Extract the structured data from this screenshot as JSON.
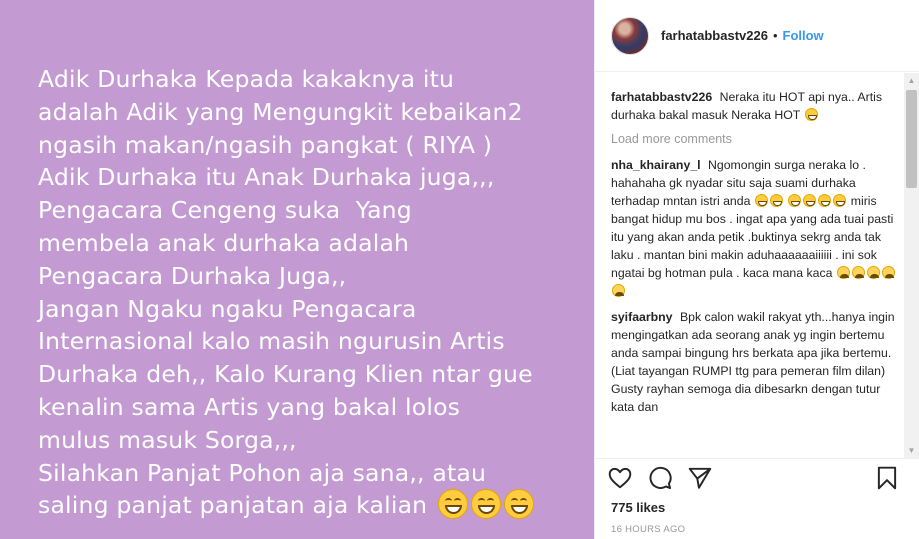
{
  "post": {
    "image_text_lines": [
      "Adik Durhaka Kepada kakaknya itu",
      "adalah Adik yang Mengungkit kebaikan2",
      "ngasih makan/ngasih pangkat ( RIYA )",
      "Adik Durhaka itu Anak Durhaka juga,,,",
      "Pengacara Cengeng suka  Yang",
      "membela anak durhaka adalah",
      "Pengacara Durhaka Juga,,",
      "Jangan Ngaku ngaku Pengacara",
      "Internasional kalo masih ngurusin Artis",
      "Durhaka deh,, Kalo Kurang Klien ntar gue",
      "kenalin sama Artis yang bakal lolos",
      "mulus masuk Sorga,,,",
      "Silahkan Panjat Pohon aja sana,, atau",
      "saling panjat panjatan aja kalian "
    ],
    "background_color": "#c39bd2"
  },
  "header": {
    "username": "farhatabbastv226",
    "separator": "•",
    "follow_label": "Follow"
  },
  "caption": {
    "username": "farhatabbastv226",
    "text": "Neraka itu HOT api nya.. Artis durhaka bakal masuk Neraka HOT"
  },
  "load_more_label": "Load more comments",
  "comments": [
    {
      "username": "nha_khairany_l",
      "part1": "Ngomongin surga neraka lo . hahahaha gk nyadar situ saja suami durhaka terhadap mntan istri anda",
      "part2": "miris bangat hidup mu bos . ingat apa yang ada tuai pasti itu yang akan anda petik .buktinya sekrg anda tak laku . mantan bini makin aduhaaaaaaiiiiii . ini sok ngatai bg hotman pula . kaca mana kaca"
    },
    {
      "username": "syifaarbny",
      "part1": "Bpk calon wakil rakyat yth...hanya ingin mengingatkan ada seorang anak yg ingin bertemu anda sampai bingung hrs berkata apa jika bertemu. (Liat tayangan RUMPI ttg para pemeran film dilan) Gusty rayhan semoga dia dibesarkn dengan tutur kata dan",
      "part2": ""
    }
  ],
  "likes_label": "775 likes",
  "timestamp": "16 HOURS AGO",
  "icons": {
    "like": "heart-icon",
    "comment": "comment-icon",
    "share": "share-icon",
    "save": "bookmark-icon"
  },
  "colors": {
    "follow": "#3897f0",
    "muted": "#999999",
    "text": "#262626"
  }
}
